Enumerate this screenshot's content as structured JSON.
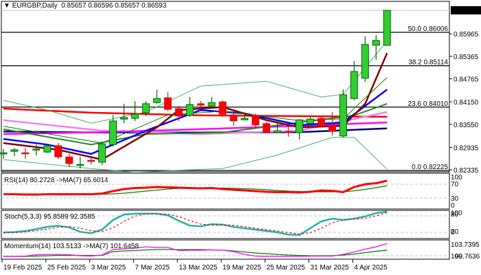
{
  "header": {
    "symbol": "EURGBP,Daily",
    "open": "0.85657",
    "high": "0.86596",
    "low": "0.85657",
    "close": "0.86593"
  },
  "colors": {
    "bull": "#32cd32",
    "bear": "#ff0000",
    "bull_border": "#006400",
    "bear_border": "#b22222"
  },
  "chart_data": {
    "type": "candlestick",
    "title": "EURGBP,Daily",
    "price_axis": {
      "labels": [
        "0.85965",
        "0.85365",
        "0.84765",
        "0.84150",
        "0.83550",
        "0.82935",
        "0.82335"
      ],
      "current": "0.86593",
      "range": [
        0.82225,
        0.86596
      ]
    },
    "fib_levels": [
      {
        "label": "50.0 0.86006",
        "price": 0.86006
      },
      {
        "label": "38.2 0.85114",
        "price": 0.85114
      },
      {
        "label": "23.6 0.84010",
        "price": 0.8401
      },
      {
        "label": "0.0 0.82225",
        "price": 0.82225
      }
    ],
    "date_labels": [
      {
        "label": "19 Feb 2025",
        "index": 0
      },
      {
        "label": "25 Feb 2025",
        "index": 4
      },
      {
        "label": "3 Mar 2025",
        "index": 8
      },
      {
        "label": "7 Mar 2025",
        "index": 12
      },
      {
        "label": "13 Mar 2025",
        "index": 16
      },
      {
        "label": "19 Mar 2025",
        "index": 20
      },
      {
        "label": "25 Mar 2025",
        "index": 24
      },
      {
        "label": "31 Mar 2025",
        "index": 28
      },
      {
        "label": "4 Apr 2025",
        "index": 32
      }
    ],
    "ohlc": [
      [
        0.8276,
        0.8289,
        0.8263,
        0.8279
      ],
      [
        0.8283,
        0.8292,
        0.827,
        0.8287
      ],
      [
        0.8279,
        0.8292,
        0.8263,
        0.8278
      ],
      [
        0.8287,
        0.8301,
        0.8272,
        0.8289
      ],
      [
        0.8281,
        0.8301,
        0.8279,
        0.8298
      ],
      [
        0.8298,
        0.8305,
        0.8263,
        0.8268
      ],
      [
        0.8268,
        0.8276,
        0.8241,
        0.825
      ],
      [
        0.8246,
        0.8268,
        0.8237,
        0.8248
      ],
      [
        0.8259,
        0.8265,
        0.8248,
        0.8256
      ],
      [
        0.8254,
        0.8307,
        0.8246,
        0.8303
      ],
      [
        0.8301,
        0.838,
        0.8296,
        0.8364
      ],
      [
        0.8369,
        0.841,
        0.8358,
        0.8373
      ],
      [
        0.8371,
        0.8417,
        0.8364,
        0.8382
      ],
      [
        0.8386,
        0.8417,
        0.8377,
        0.841
      ],
      [
        0.8413,
        0.8448,
        0.841,
        0.8424
      ],
      [
        0.8426,
        0.8441,
        0.839,
        0.8395
      ],
      [
        0.8397,
        0.8404,
        0.8364,
        0.8377
      ],
      [
        0.8379,
        0.8428,
        0.8375,
        0.8408
      ],
      [
        0.841,
        0.8417,
        0.8397,
        0.8406
      ],
      [
        0.8404,
        0.8428,
        0.8401,
        0.8413
      ],
      [
        0.8415,
        0.8419,
        0.8375,
        0.8382
      ],
      [
        0.838,
        0.839,
        0.8351,
        0.8364
      ],
      [
        0.8367,
        0.8384,
        0.8366,
        0.8371
      ],
      [
        0.8379,
        0.8384,
        0.8344,
        0.8353
      ],
      [
        0.8357,
        0.8362,
        0.8331,
        0.8333
      ],
      [
        0.8333,
        0.8366,
        0.8331,
        0.8338
      ],
      [
        0.8336,
        0.8351,
        0.8322,
        0.8333
      ],
      [
        0.8333,
        0.8369,
        0.8314,
        0.8367
      ],
      [
        0.8357,
        0.8377,
        0.8347,
        0.8369
      ],
      [
        0.8371,
        0.8379,
        0.8347,
        0.8351
      ],
      [
        0.8353,
        0.8388,
        0.8325,
        0.8336
      ],
      [
        0.8324,
        0.8448,
        0.832,
        0.8434
      ],
      [
        0.8424,
        0.8524,
        0.8419,
        0.8496
      ],
      [
        0.8478,
        0.859,
        0.8468,
        0.8568
      ],
      [
        0.8566,
        0.8593,
        0.8527,
        0.8579
      ],
      [
        0.85657,
        0.86596,
        0.85657,
        0.86593
      ]
    ],
    "overlays": [
      {
        "name": "ma-red",
        "color": "#ff0000",
        "width": 2.5,
        "points": [
          [
            0,
            0.8397
          ],
          [
            8,
            0.8386
          ],
          [
            18,
            0.8379
          ],
          [
            35,
            0.8375
          ]
        ]
      },
      {
        "name": "ma-navy",
        "color": "#000080",
        "width": 2.5,
        "points": [
          [
            0,
            0.8336
          ],
          [
            9,
            0.8333
          ],
          [
            18,
            0.8333
          ],
          [
            27,
            0.8334
          ],
          [
            35,
            0.8344
          ]
        ]
      },
      {
        "name": "ma-violet",
        "color": "#ee82ee",
        "width": 2.5,
        "points": [
          [
            0,
            0.8366
          ],
          [
            9,
            0.8338
          ],
          [
            18,
            0.8329
          ],
          [
            27,
            0.8338
          ],
          [
            35,
            0.8388
          ]
        ]
      },
      {
        "name": "ma-magenta",
        "color": "#ff00ff",
        "width": 2.5,
        "points": [
          [
            0,
            0.8329
          ],
          [
            9,
            0.8334
          ],
          [
            18,
            0.8342
          ],
          [
            27,
            0.8351
          ],
          [
            35,
            0.836
          ]
        ]
      },
      {
        "name": "ma-green",
        "color": "#228b22",
        "width": 2,
        "points": [
          [
            0,
            0.8342
          ],
          [
            8,
            0.8301
          ],
          [
            13,
            0.8329
          ],
          [
            20,
            0.8333
          ],
          [
            27,
            0.836
          ],
          [
            32,
            0.8379
          ],
          [
            35,
            0.841
          ]
        ]
      },
      {
        "name": "ma-blue",
        "color": "#0000ff",
        "width": 2.5,
        "points": [
          [
            0,
            0.8316
          ],
          [
            4,
            0.8301
          ],
          [
            8,
            0.8276
          ],
          [
            13,
            0.8338
          ],
          [
            18,
            0.8393
          ],
          [
            22,
            0.8384
          ],
          [
            27,
            0.8353
          ],
          [
            31,
            0.836
          ],
          [
            35,
            0.8448
          ]
        ]
      },
      {
        "name": "ma-maroon",
        "color": "#800000",
        "width": 2.5,
        "points": [
          [
            0,
            0.8305
          ],
          [
            5,
            0.8287
          ],
          [
            9,
            0.8261
          ],
          [
            14,
            0.8347
          ],
          [
            16,
            0.8393
          ],
          [
            20,
            0.8401
          ],
          [
            24,
            0.8366
          ],
          [
            27,
            0.8347
          ],
          [
            31,
            0.8351
          ],
          [
            33,
            0.841
          ],
          [
            35,
            0.8545
          ]
        ]
      },
      {
        "name": "bb-upper",
        "color": "#3cb371",
        "width": 1,
        "points": [
          [
            0,
            0.8419
          ],
          [
            4,
            0.8393
          ],
          [
            8,
            0.8358
          ],
          [
            13,
            0.8388
          ],
          [
            18,
            0.8457
          ],
          [
            24,
            0.847
          ],
          [
            29,
            0.8428
          ],
          [
            31,
            0.8435
          ],
          [
            35,
            0.8577
          ]
        ]
      },
      {
        "name": "bb-middle",
        "color": "#008000",
        "width": 1,
        "points": [
          [
            0,
            0.835
          ],
          [
            9,
            0.8305
          ],
          [
            15,
            0.838
          ],
          [
            20,
            0.839
          ],
          [
            27,
            0.8365
          ],
          [
            31,
            0.837
          ],
          [
            35,
            0.848
          ]
        ]
      },
      {
        "name": "bb-lower",
        "color": "#3cb371",
        "width": 1,
        "points": [
          [
            0,
            0.8261
          ],
          [
            8,
            0.8237
          ],
          [
            12,
            0.8228
          ],
          [
            20,
            0.8237
          ],
          [
            25,
            0.8273
          ],
          [
            30,
            0.832
          ],
          [
            32,
            0.832
          ],
          [
            35,
            0.8235
          ]
        ]
      }
    ],
    "rsi": {
      "label": "RSI(14) 80.2728  ->MA(7) 65.6014",
      "axis": [
        "100",
        "70",
        "30",
        "0"
      ],
      "values": [
        41,
        41,
        40,
        40,
        41,
        41,
        41,
        41,
        41,
        43,
        50,
        56,
        59,
        60,
        62,
        61,
        60,
        59,
        58,
        59,
        56,
        54,
        52,
        50,
        48,
        47,
        47,
        46,
        48,
        52,
        51,
        47,
        62,
        70,
        73,
        80.27
      ],
      "ma": [
        42,
        42,
        42,
        42,
        41,
        41,
        41,
        41,
        41,
        41,
        42,
        44,
        47,
        50,
        53,
        56,
        58,
        59,
        60,
        59,
        59,
        58,
        57,
        56,
        54,
        52,
        50,
        49,
        48,
        48,
        48,
        48,
        51,
        55,
        60,
        65.6
      ]
    },
    "stoch": {
      "label": "Stoch(5,3,3) 95.8589 92.3585",
      "axis": [
        "100",
        "80",
        "20",
        "0"
      ],
      "main": [
        20,
        21,
        25,
        32,
        40,
        44,
        38,
        22,
        17,
        30,
        65,
        85,
        88,
        88,
        88,
        82,
        62,
        45,
        42,
        50,
        48,
        40,
        35,
        30,
        25,
        20,
        12,
        10,
        35,
        60,
        70,
        65,
        70,
        78,
        90,
        95.86
      ],
      "signal": [
        18,
        19,
        22,
        26,
        32,
        38,
        41,
        35,
        26,
        23,
        37,
        60,
        79,
        87,
        88,
        86,
        77,
        63,
        50,
        46,
        47,
        46,
        41,
        35,
        30,
        25,
        19,
        14,
        19,
        35,
        55,
        65,
        68,
        71,
        80,
        92.36
      ]
    },
    "momentum": {
      "label": "Momentum(14) 103.5133  ->MA(7) 101.6458",
      "axis": [
        "103.7395",
        "100",
        "99.7636"
      ],
      "values": [
        99.8,
        99.8,
        99.9,
        100.3,
        100.4,
        100.4,
        100.3,
        100.0,
        99.9,
        100.2,
        101.8,
        102,
        102.2,
        102.6,
        102.4,
        102.4,
        101.5,
        101.6,
        101.6,
        101.7,
        101.6,
        101.2,
        100.4,
        99.9,
        99.8,
        99.8,
        99.8,
        99.8,
        99.9,
        99.9,
        99.9,
        100.4,
        101.1,
        101.9,
        102.6,
        103.51
      ],
      "ma": [
        99.8,
        99.8,
        99.8,
        99.9,
        100.0,
        100.1,
        100.1,
        100.1,
        100.1,
        100.1,
        101.2,
        101.4,
        101.5,
        101.7,
        101.8,
        101.8,
        101.8,
        101.8,
        101.8,
        101.7,
        101.6,
        101.4,
        101.1,
        100.8,
        100.6,
        100.4,
        100.2,
        100.1,
        100.0,
        100.0,
        100.0,
        100.2,
        100.5,
        100.9,
        101.3,
        101.65
      ]
    }
  }
}
